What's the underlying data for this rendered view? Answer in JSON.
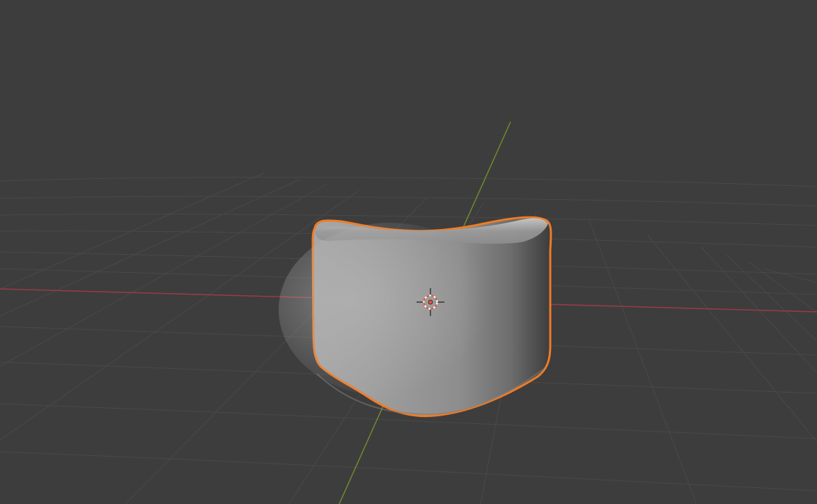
{
  "app": {
    "context": "3D viewport"
  },
  "viewport": {
    "background_color": "#3d3d3d",
    "grid_color": "#4a4a4a",
    "x_axis_color": "#9b3b45",
    "y_axis_color": "#6f8b2e",
    "selection_outline_color": "#f07c25",
    "object_shading_color": "#9a9a9a",
    "origin_marker_color": "#e4553e"
  },
  "scene": {
    "selected_object": {
      "type": "mesh",
      "selected": true
    },
    "3d_cursor": {
      "visible": true,
      "icon": "crosshair-icon"
    }
  }
}
